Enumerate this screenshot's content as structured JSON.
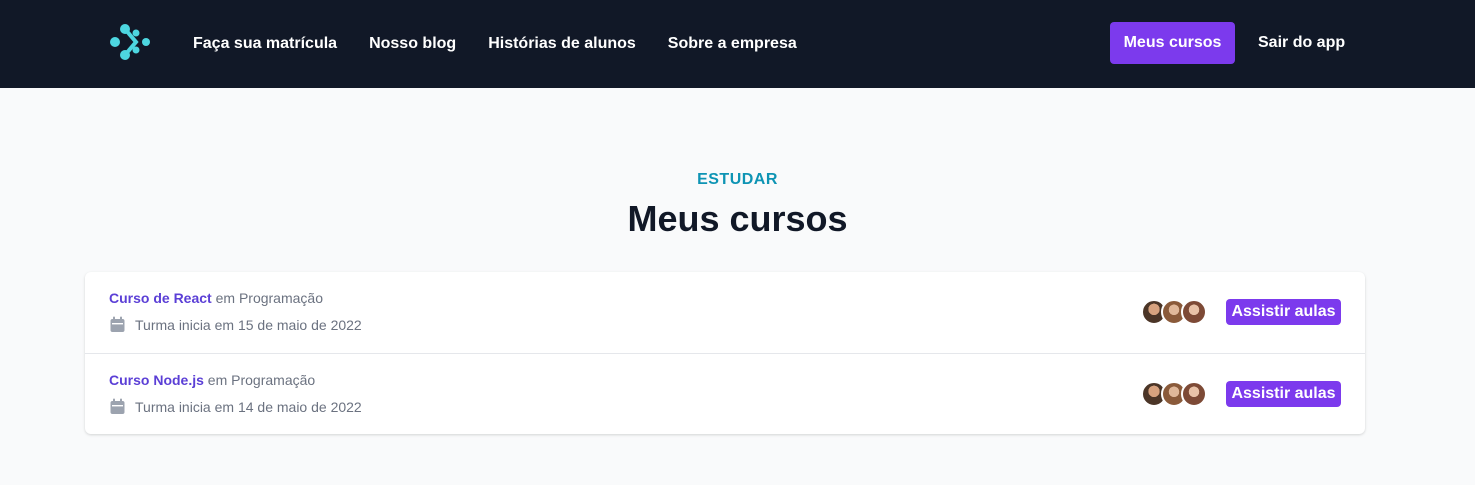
{
  "nav": {
    "links": [
      "Faça sua matrícula",
      "Nosso blog",
      "Histórias de alunos",
      "Sobre a empresa"
    ],
    "primary_label": "Meus cursos",
    "logout_label": "Sair do app"
  },
  "header": {
    "eyebrow": "ESTUDAR",
    "title": "Meus cursos"
  },
  "courses": [
    {
      "name": "Curso de React",
      "in_text": "em",
      "category": "Programação",
      "date_text": "Turma inicia em 15 de maio de 2022",
      "button_label": "Assistir aulas"
    },
    {
      "name": "Curso Node.js",
      "in_text": "em",
      "category": "Programação",
      "date_text": "Turma inicia em 14 de maio de 2022",
      "button_label": "Assistir aulas"
    }
  ],
  "icons": {
    "logo": "logo-icon",
    "calendar": "calendar-icon",
    "avatar": "avatar"
  },
  "colors": {
    "navbar": "#111827",
    "accent": "#7c3aed",
    "eyebrow": "#0e94b4",
    "logo": "#4dd6e0"
  }
}
